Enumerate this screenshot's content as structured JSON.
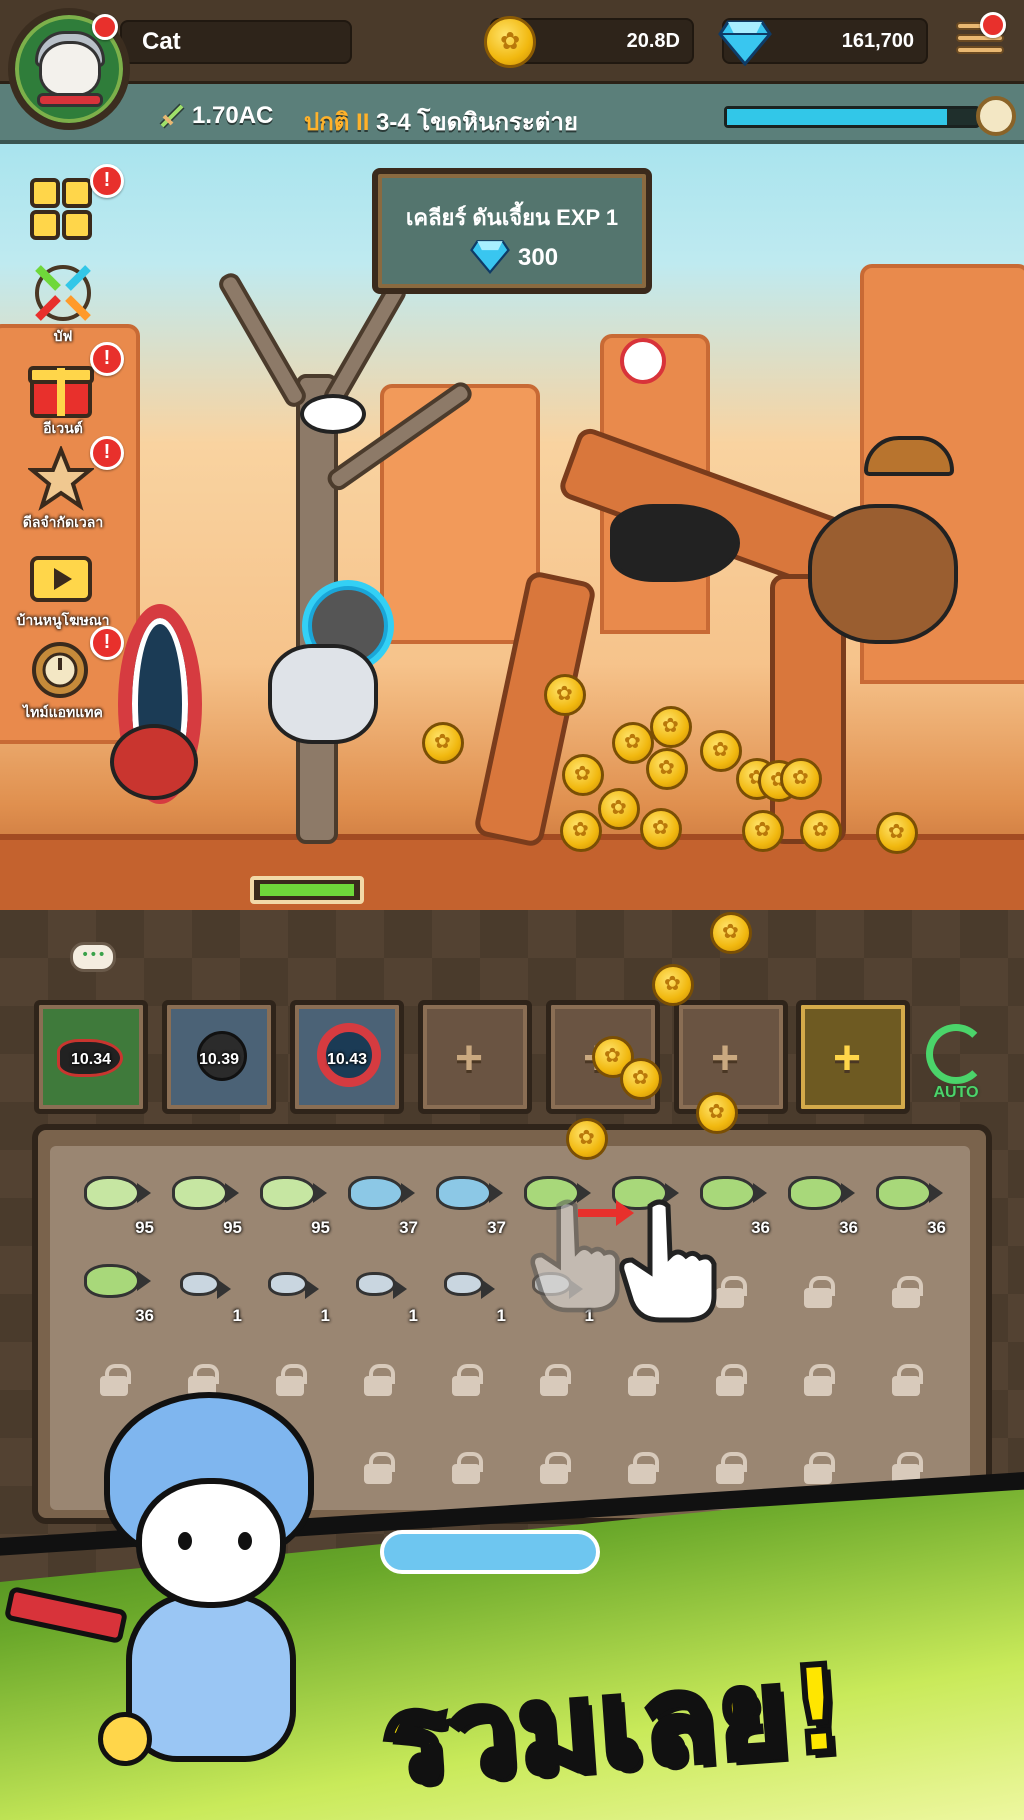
{
  "player": {
    "name": "Cat"
  },
  "resources": {
    "gold": "20.8D",
    "gems": "161,700"
  },
  "stage": {
    "power": "1.70AC",
    "difficulty": "ปกติ II",
    "name": "3-4 โขดหินกระต่าย",
    "timer_progress": 0.88
  },
  "mission": {
    "title": "เคลียร์ ดันเจี้ยน EXP 1",
    "reward": "300"
  },
  "side_menu": [
    {
      "label": "",
      "icon": "grid-icon",
      "alert": true
    },
    {
      "label": "บัฟ",
      "icon": "buff-icon",
      "alert": false
    },
    {
      "label": "อีเวนต์",
      "icon": "gift-icon",
      "alert": true
    },
    {
      "label": "ดีลจำกัดเวลา",
      "icon": "star-deal-icon",
      "alert": true
    },
    {
      "label": "บ้านหนูโฆษณา",
      "icon": "ad-house-icon",
      "alert": false
    },
    {
      "label": "ไทม์แอทแทค",
      "icon": "time-attack-icon",
      "alert": true
    }
  ],
  "weapon_slots": [
    {
      "level": "10.34",
      "icon": "shark-rocket-icon"
    },
    {
      "level": "10.39",
      "icon": "bomb-icon"
    },
    {
      "level": "10.43",
      "icon": "portal-icon"
    },
    {
      "level": "",
      "icon": "plus-icon"
    },
    {
      "level": "",
      "icon": "plus-icon"
    },
    {
      "level": "",
      "icon": "plus-icon"
    },
    {
      "level": "",
      "icon": "plus-icon"
    }
  ],
  "auto_label": "AUTO",
  "merge_grid": {
    "row1": [
      "95",
      "95",
      "95",
      "37",
      "37",
      "",
      "",
      "36",
      "36",
      "36"
    ],
    "row2": [
      "36",
      "1",
      "1",
      "1",
      "1",
      "1",
      "",
      "",
      "",
      ""
    ]
  },
  "banner_text": "รวมเลย!",
  "colors": {
    "accent_gold": "#f1b80f",
    "gem_blue": "#32c7e8",
    "banner_yellow": "#ffe600",
    "hp_green": "#6fd83a"
  }
}
